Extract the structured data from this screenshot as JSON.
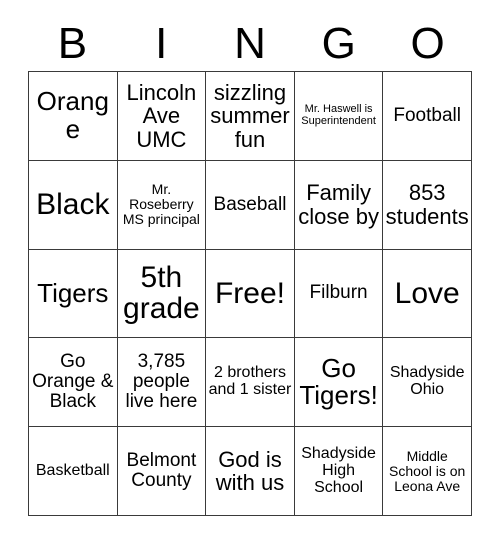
{
  "card": {
    "header_letters": [
      "B",
      "I",
      "N",
      "G",
      "O"
    ],
    "free_space_label": "Free!",
    "rows": [
      [
        {
          "text": "Orange",
          "size": "xl"
        },
        {
          "text": "Lincoln Ave UMC",
          "size": "lg"
        },
        {
          "text": "sizzling summer fun",
          "size": "lg"
        },
        {
          "text": "Mr. Haswell is Superintendent",
          "size": "xxs"
        },
        {
          "text": "Football",
          "size": "md"
        }
      ],
      [
        {
          "text": "Black",
          "size": "xxl"
        },
        {
          "text": "Mr. Roseberry MS principal",
          "size": "xs"
        },
        {
          "text": "Baseball",
          "size": "md"
        },
        {
          "text": "Family close by",
          "size": "lg"
        },
        {
          "text": "853 students",
          "size": "lg"
        }
      ],
      [
        {
          "text": "Tigers",
          "size": "xl"
        },
        {
          "text": "5th grade",
          "size": "xxl"
        },
        {
          "text": "Free!",
          "size": "xxl"
        },
        {
          "text": "Filburn",
          "size": "md"
        },
        {
          "text": "Love",
          "size": "xxl"
        }
      ],
      [
        {
          "text": "Go Orange & Black",
          "size": "md"
        },
        {
          "text": "3,785 people live here",
          "size": "md"
        },
        {
          "text": "2 brothers and 1 sister",
          "size": "sm"
        },
        {
          "text": "Go Tigers!",
          "size": "xl"
        },
        {
          "text": "Shadyside Ohio",
          "size": "sm"
        }
      ],
      [
        {
          "text": "Basketball",
          "size": "sm"
        },
        {
          "text": "Belmont County",
          "size": "md"
        },
        {
          "text": "God is with us",
          "size": "lg"
        },
        {
          "text": "Shadyside High School",
          "size": "sm"
        },
        {
          "text": "Middle School is on Leona Ave",
          "size": "xs"
        }
      ]
    ]
  },
  "colors": {
    "background": "#ffffff",
    "text": "#000000",
    "border": "#3a3a3a"
  }
}
